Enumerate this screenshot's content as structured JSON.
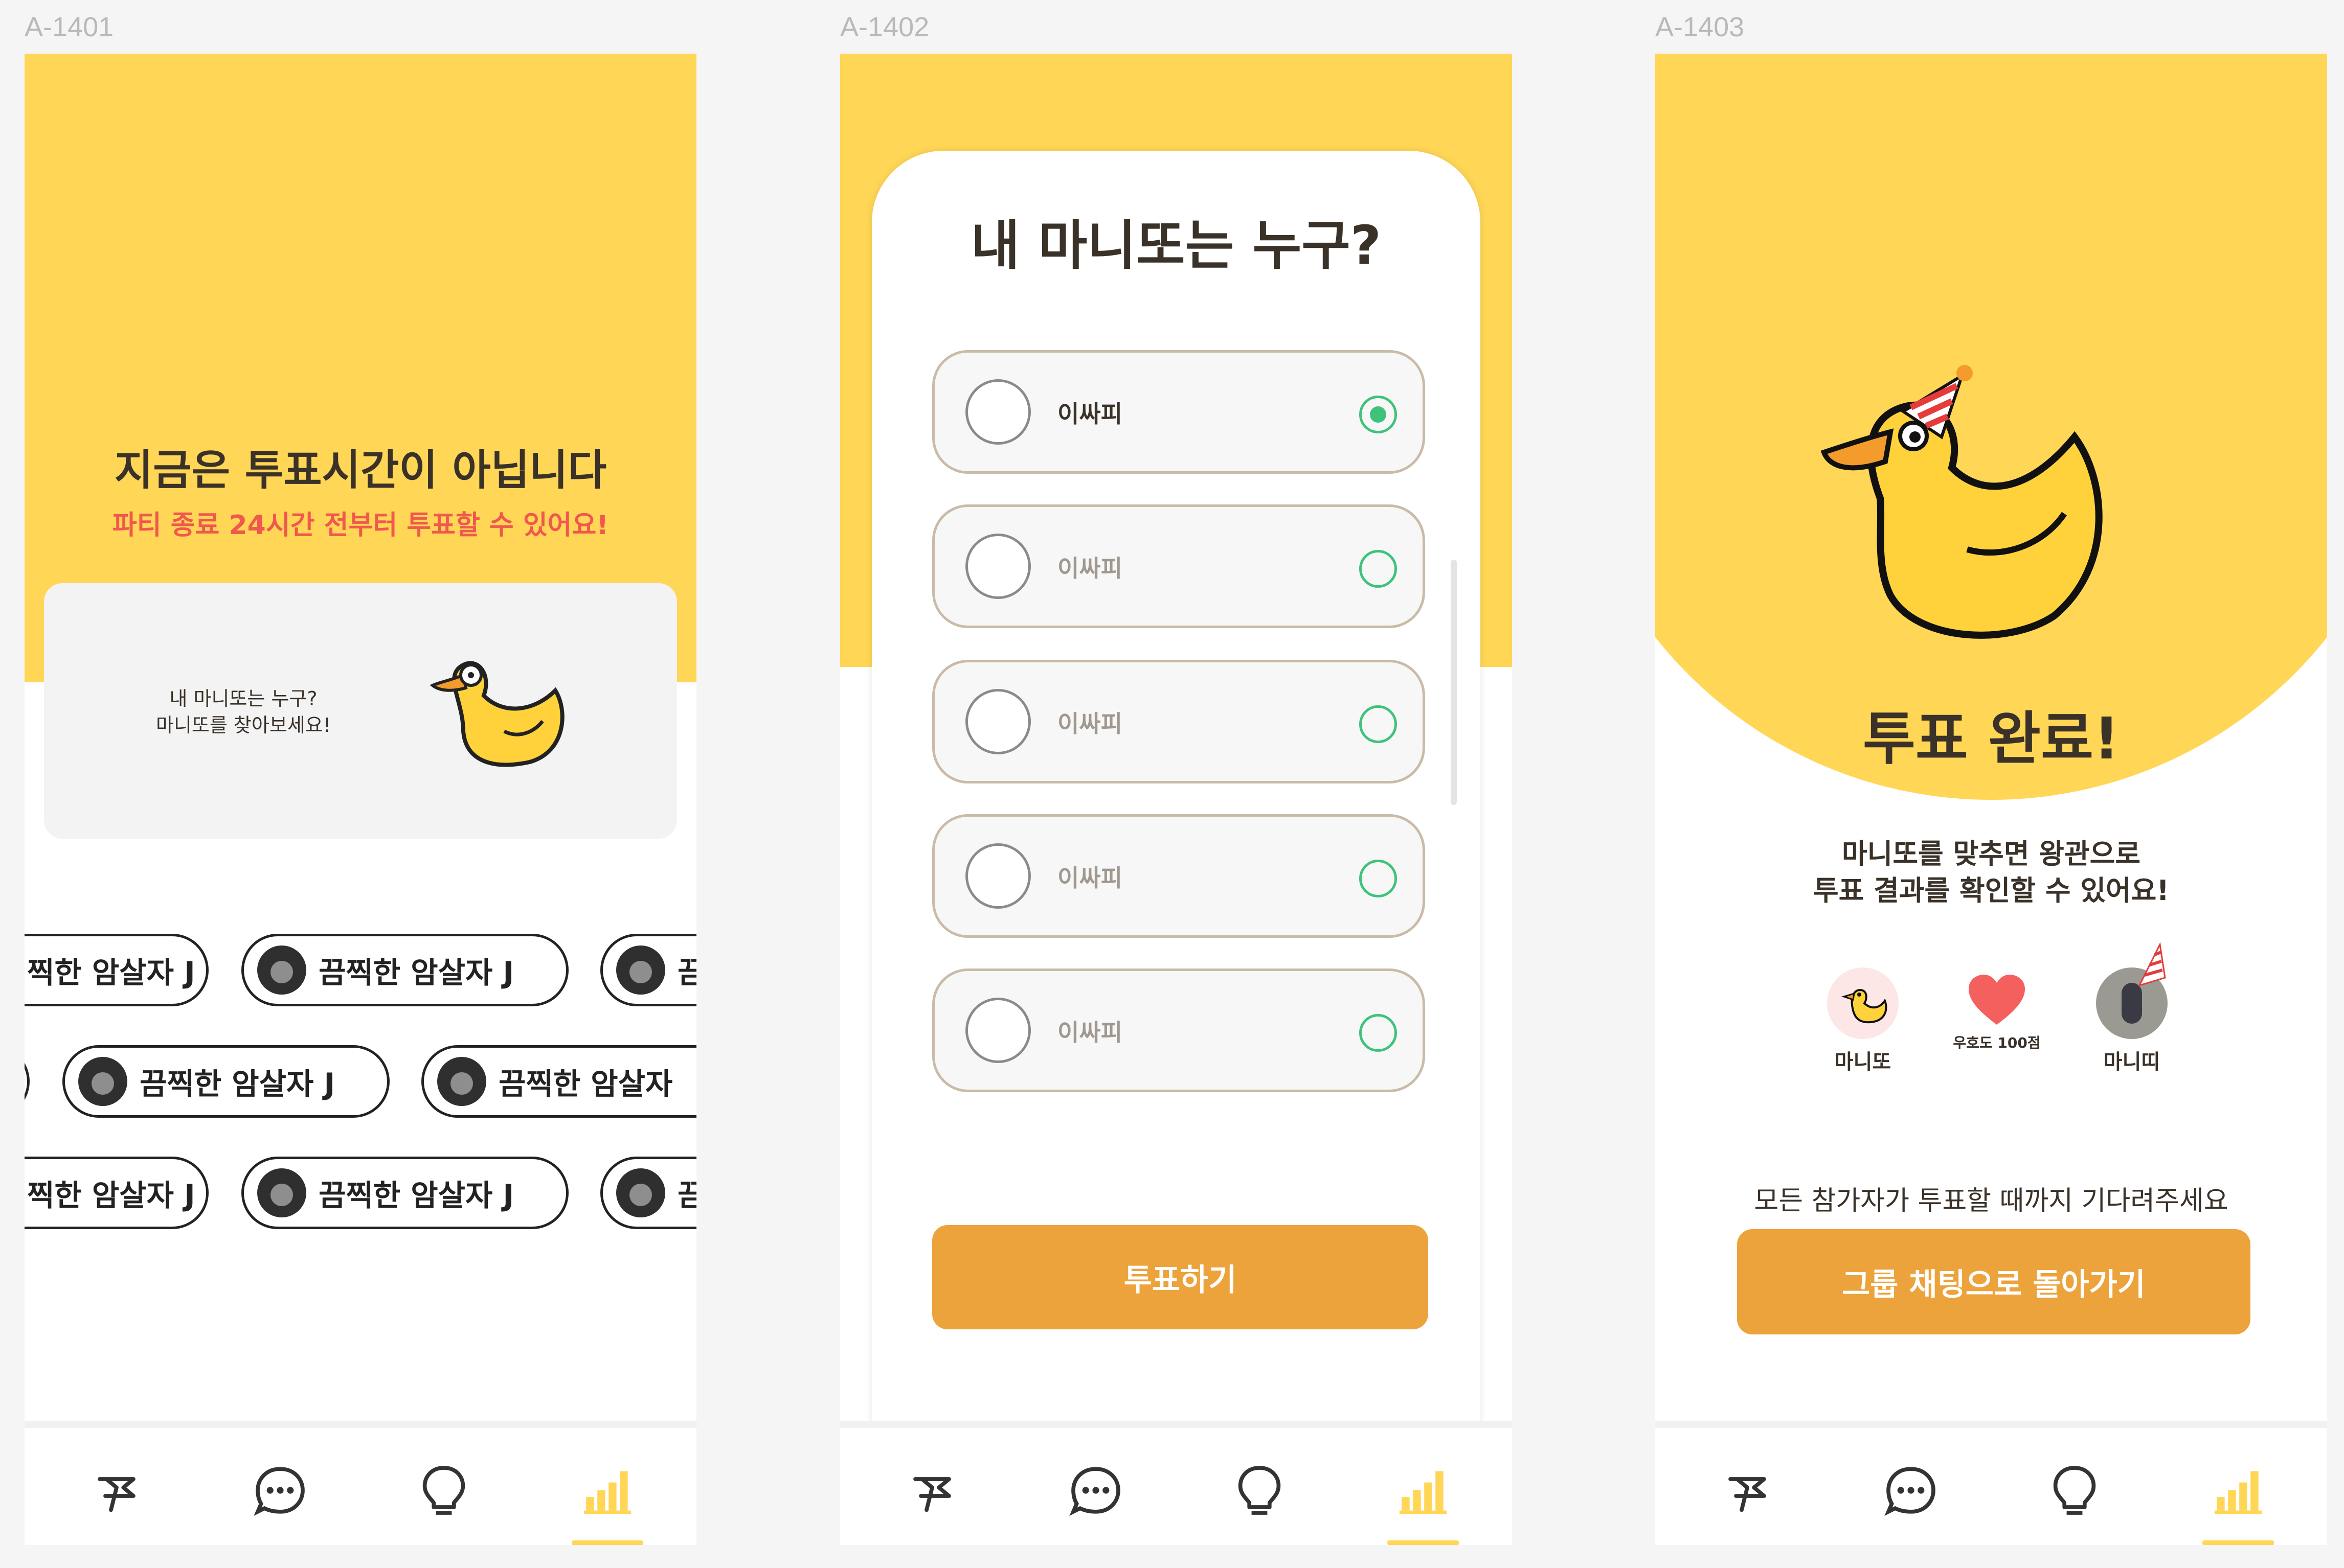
{
  "frames": [
    {
      "label": "A-1401"
    },
    {
      "label": "A-1402"
    },
    {
      "label": "A-1403"
    }
  ],
  "screen1": {
    "title": "지금은 투표시간이 아닙니다",
    "subtitle": "파티 종료 24시간 전부터 투표할 수 있어요!",
    "card": {
      "line1": "내 마니또는 누구?",
      "line2": "마니또를 찾아보세요!"
    },
    "pill_name": "끔찍한 암살자 J",
    "pill_name_partial": "찍한 암살자 J",
    "pill_name_cut": "끔찍한 암살자"
  },
  "screen2": {
    "question": "내 마니또는 누구?",
    "options": [
      {
        "name": "이싸피",
        "selected": true
      },
      {
        "name": "이싸피",
        "selected": false
      },
      {
        "name": "이싸피",
        "selected": false
      },
      {
        "name": "이싸피",
        "selected": false
      },
      {
        "name": "이싸피",
        "selected": false
      }
    ],
    "vote_button": "투표하기"
  },
  "screen3": {
    "title": "투표 완료!",
    "desc_line1": "마니또를 맞추면 왕관으로",
    "desc_line2": "투표 결과를 확인할 수 있어요!",
    "manitto_label": "마니또",
    "heart_label": "우호도 100점",
    "manitti_label": "마니띠",
    "wait_text": "모든 참가자가 투표할 때까지 기다려주세요",
    "back_button": "그룹 채팅으로 돌아가기"
  },
  "tabs": [
    {
      "icon": "flag-icon"
    },
    {
      "icon": "chat-icon"
    },
    {
      "icon": "lightbulb-icon"
    },
    {
      "icon": "chart-icon",
      "active": true
    }
  ],
  "colors": {
    "primary": "#ffd655",
    "accent": "#eda33b",
    "alert": "#f0584e",
    "radio": "#3fc27a",
    "text": "#3a3128"
  }
}
